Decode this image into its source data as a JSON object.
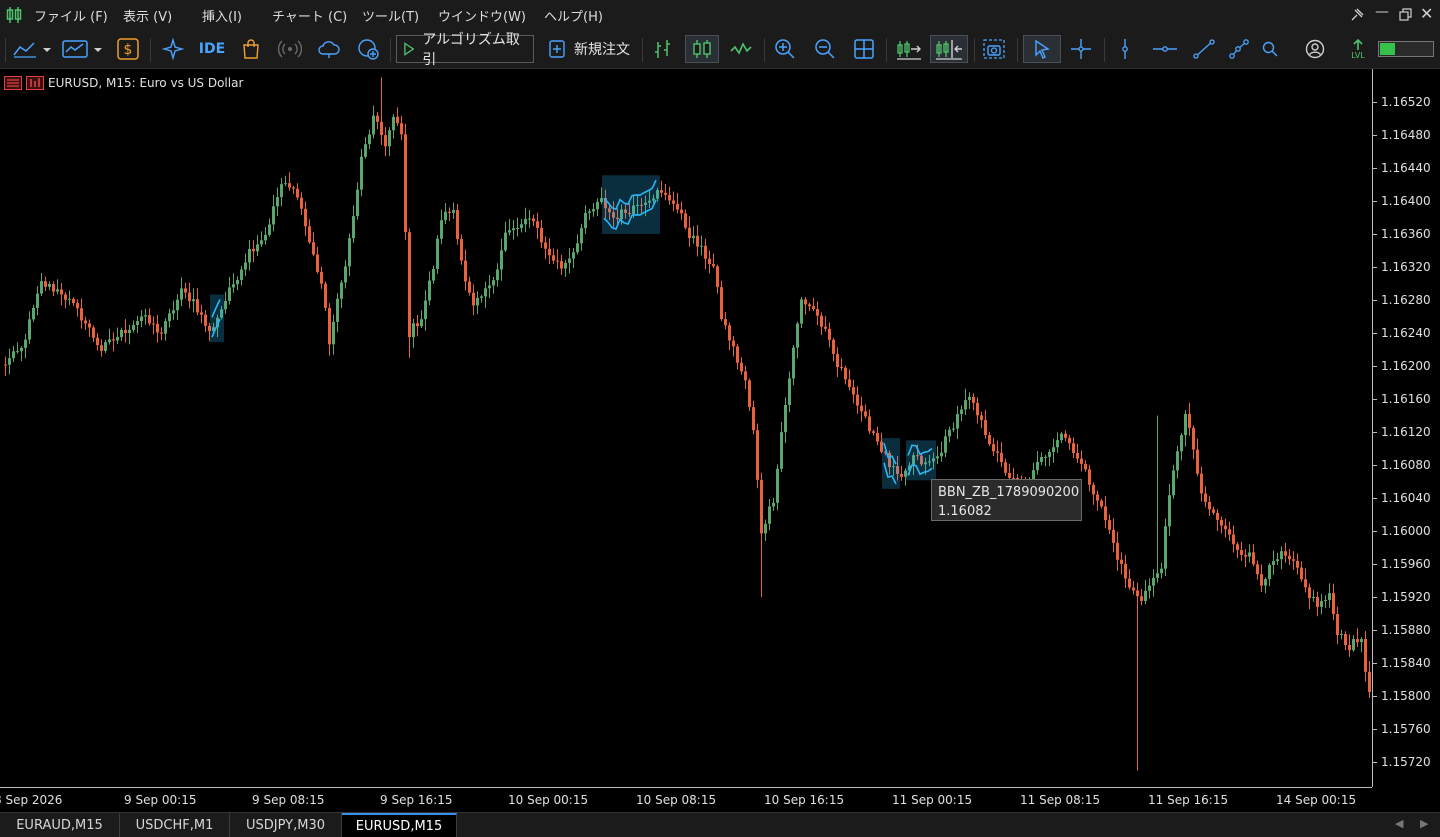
{
  "menu": {
    "items": [
      "ファイル (F)",
      "表示 (V)",
      "挿入(I)",
      "チャート (C)",
      "ツール(T)",
      "ウインドウ(W)",
      "ヘルプ(H)"
    ]
  },
  "toolbar": {
    "algo_label": "アルゴリズム取引",
    "new_order_label": "新規注文",
    "ide_label": "IDE",
    "lvl_label": "LVL"
  },
  "chart": {
    "title": "EURUSD, M15:  Euro vs US Dollar",
    "colors": {
      "bull": "#5aa66e",
      "bear": "#e8623e",
      "highlight": "#29b6f6"
    },
    "price_labels": [
      "1.16520",
      "1.16480",
      "1.16440",
      "1.16400",
      "1.16360",
      "1.16320",
      "1.16280",
      "1.16240",
      "1.16200",
      "1.16160",
      "1.16120",
      "1.16080",
      "1.16040",
      "1.16000",
      "1.15960",
      "1.15920",
      "1.15880",
      "1.15840",
      "1.15800",
      "1.15760",
      "1.15720"
    ],
    "time_labels": [
      "8 Sep 2026",
      "9 Sep 00:15",
      "9 Sep 08:15",
      "9 Sep 16:15",
      "10 Sep 00:15",
      "10 Sep 08:15",
      "10 Sep 16:15",
      "11 Sep 00:15",
      "11 Sep 08:15",
      "11 Sep 16:15",
      "14 Sep 00:15"
    ]
  },
  "chart_data": {
    "type": "candlestick",
    "symbol": "EURUSD",
    "timeframe": "M15",
    "ylim": [
      1.1569,
      1.1656
    ],
    "y_ticks": [
      1.1652,
      1.1648,
      1.1644,
      1.164,
      1.1636,
      1.1632,
      1.1628,
      1.1624,
      1.162,
      1.1616,
      1.1612,
      1.1608,
      1.1604,
      1.16,
      1.1596,
      1.1592,
      1.1588,
      1.1584,
      1.158,
      1.1576,
      1.1572
    ],
    "x_ticks": [
      "8 Sep 2026",
      "9 Sep 00:15",
      "9 Sep 08:15",
      "9 Sep 16:15",
      "10 Sep 00:15",
      "10 Sep 08:15",
      "10 Sep 16:15",
      "11 Sep 00:15",
      "11 Sep 08:15",
      "11 Sep 16:15",
      "14 Sep 00:15"
    ],
    "close_path": [
      [
        0,
        1.162
      ],
      [
        5,
        1.1622
      ],
      [
        10,
        1.163
      ],
      [
        15,
        1.1629
      ],
      [
        20,
        1.1626
      ],
      [
        25,
        1.1622
      ],
      [
        30,
        1.1624
      ],
      [
        35,
        1.1626
      ],
      [
        40,
        1.1624
      ],
      [
        45,
        1.1629
      ],
      [
        48,
        1.1628
      ],
      [
        52,
        1.1624
      ],
      [
        55,
        1.1627
      ],
      [
        58,
        1.163
      ],
      [
        62,
        1.1634
      ],
      [
        66,
        1.1636
      ],
      [
        70,
        1.1642
      ],
      [
        74,
        1.1641
      ],
      [
        77,
        1.1635
      ],
      [
        80,
        1.163
      ],
      [
        82,
        1.1623
      ],
      [
        85,
        1.163
      ],
      [
        88,
        1.1638
      ],
      [
        90,
        1.1645
      ],
      [
        93,
        1.165
      ],
      [
        96,
        1.1647
      ],
      [
        98,
        1.165
      ],
      [
        100,
        1.1648
      ],
      [
        102,
        1.1624
      ],
      [
        105,
        1.1626
      ],
      [
        108,
        1.1632
      ],
      [
        110,
        1.1638
      ],
      [
        113,
        1.1639
      ],
      [
        116,
        1.163
      ],
      [
        118,
        1.1627
      ],
      [
        121,
        1.1629
      ],
      [
        124,
        1.1632
      ],
      [
        126,
        1.1636
      ],
      [
        130,
        1.1637
      ],
      [
        133,
        1.1638
      ],
      [
        136,
        1.1634
      ],
      [
        140,
        1.1632
      ],
      [
        143,
        1.1634
      ],
      [
        146,
        1.1638
      ],
      [
        150,
        1.164
      ],
      [
        153,
        1.1638
      ],
      [
        157,
        1.1639
      ],
      [
        160,
        1.164
      ],
      [
        164,
        1.1641
      ],
      [
        168,
        1.164
      ],
      [
        172,
        1.1636
      ],
      [
        175,
        1.1634
      ],
      [
        178,
        1.1632
      ],
      [
        180,
        1.1626
      ],
      [
        183,
        1.1622
      ],
      [
        186,
        1.1618
      ],
      [
        188,
        1.1612
      ],
      [
        190,
        1.16
      ],
      [
        193,
        1.1604
      ],
      [
        195,
        1.1612
      ],
      [
        198,
        1.1622
      ],
      [
        200,
        1.1628
      ],
      [
        203,
        1.1627
      ],
      [
        206,
        1.1624
      ],
      [
        209,
        1.162
      ],
      [
        212,
        1.1618
      ],
      [
        215,
        1.1614
      ],
      [
        218,
        1.1612
      ],
      [
        222,
        1.1608
      ],
      [
        225,
        1.1606
      ],
      [
        228,
        1.1609
      ],
      [
        231,
        1.1608
      ],
      [
        234,
        1.1609
      ],
      [
        237,
        1.1612
      ],
      [
        240,
        1.1615
      ],
      [
        242,
        1.1616
      ],
      [
        244,
        1.1614
      ],
      [
        246,
        1.1612
      ],
      [
        250,
        1.1608
      ],
      [
        253,
        1.1606
      ],
      [
        256,
        1.1605
      ],
      [
        259,
        1.1608
      ],
      [
        262,
        1.161
      ],
      [
        265,
        1.1612
      ],
      [
        268,
        1.161
      ],
      [
        271,
        1.1607
      ],
      [
        274,
        1.1604
      ],
      [
        277,
        1.16
      ],
      [
        279,
        1.1597
      ],
      [
        282,
        1.1593
      ],
      [
        285,
        1.1592
      ],
      [
        288,
        1.1594
      ],
      [
        290,
        1.1596
      ],
      [
        292,
        1.1604
      ],
      [
        294,
        1.161
      ],
      [
        296,
        1.1614
      ],
      [
        298,
        1.161
      ],
      [
        300,
        1.1604
      ],
      [
        303,
        1.1602
      ],
      [
        306,
        1.16
      ],
      [
        309,
        1.1598
      ],
      [
        312,
        1.1597
      ],
      [
        315,
        1.1594
      ],
      [
        318,
        1.1596
      ],
      [
        320,
        1.1597
      ],
      [
        323,
        1.1596
      ],
      [
        326,
        1.1593
      ],
      [
        329,
        1.1591
      ],
      [
        332,
        1.1592
      ],
      [
        334,
        1.1588
      ],
      [
        337,
        1.1586
      ],
      [
        340,
        1.1587
      ],
      [
        342,
        1.158
      ],
      [
        344,
        1.1576
      ]
    ],
    "spikes": [
      {
        "i": 190,
        "low": 1.1592
      },
      {
        "i": 102,
        "low": 1.1621
      },
      {
        "i": 95,
        "high": 1.1655
      },
      {
        "i": 284,
        "low": 1.1571
      },
      {
        "i": 289,
        "high": 1.1614
      }
    ],
    "highlight_boxes": [
      {
        "i0": 53,
        "i1": 55
      },
      {
        "i0": 151,
        "i1": 164
      },
      {
        "i0": 221,
        "i1": 224
      },
      {
        "i0": 227,
        "i1": 233
      }
    ],
    "tooltip": {
      "object_name": "BBN_ZB_1789090200",
      "price": "1.16082"
    }
  },
  "tabs": [
    "EURAUD,M15",
    "USDCHF,M1",
    "USDJPY,M30",
    "EURUSD,M15"
  ],
  "active_tab": "EURUSD,M15"
}
